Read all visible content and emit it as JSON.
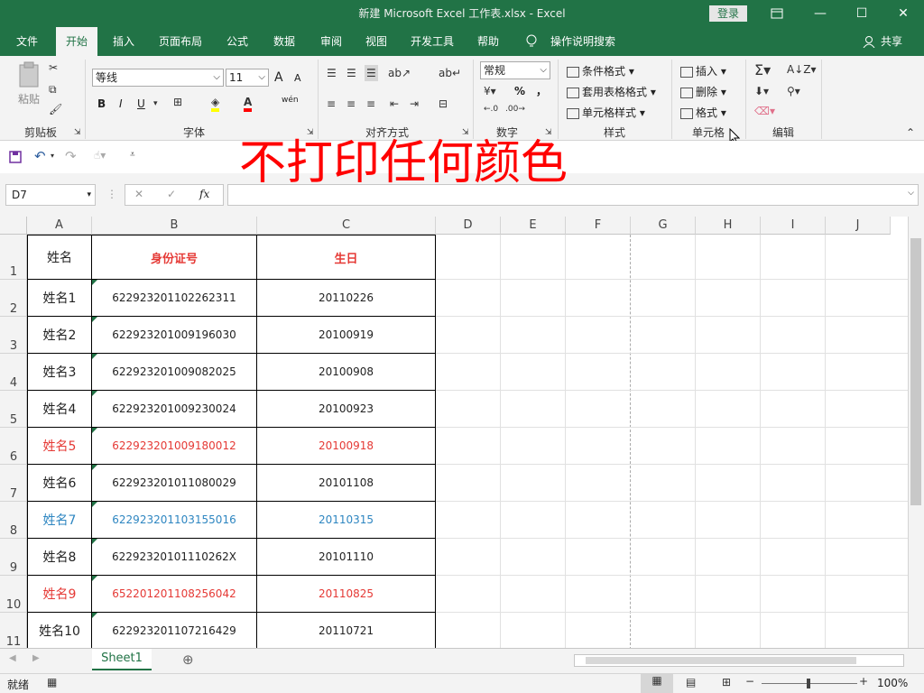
{
  "titlebar": {
    "title": "新建 Microsoft Excel 工作表.xlsx  -  Excel",
    "signin": "登录",
    "restore_icon": "ribbon-display-icon",
    "minimize": "—",
    "maximize": "☐",
    "close": "✕"
  },
  "tabs": [
    "文件",
    "开始",
    "插入",
    "页面布局",
    "公式",
    "数据",
    "审阅",
    "视图",
    "开发工具",
    "帮助"
  ],
  "tell_me": "操作说明搜索",
  "share": "共享",
  "ribbon": {
    "clipboard": {
      "paste": "粘贴",
      "label": "剪贴板"
    },
    "font": {
      "name": "等线",
      "size": "11",
      "bold": "B",
      "italic": "I",
      "underline": "U",
      "grow": "A",
      "shrink": "A",
      "wen": "wén",
      "label": "字体"
    },
    "alignment": {
      "label": "对齐方式"
    },
    "number": {
      "format": "常规",
      "percent": "%",
      "comma": "，",
      "label": "数字"
    },
    "styles": {
      "cond": "条件格式",
      "table": "套用表格格式",
      "cell": "单元格样式",
      "label": "样式"
    },
    "cells": {
      "insert": "插入",
      "delete": "删除",
      "format": "格式",
      "label": "单元格"
    },
    "editing": {
      "label": "编辑"
    }
  },
  "formula_bar": {
    "name_box": "D7",
    "fx": "fx",
    "formula": ""
  },
  "columns": [
    "A",
    "B",
    "C",
    "D",
    "E",
    "F",
    "G",
    "H",
    "I",
    "J"
  ],
  "rows": [
    "1",
    "2",
    "3",
    "4",
    "5",
    "6",
    "7",
    "8",
    "9",
    "10",
    "11"
  ],
  "header_row": {
    "name": "姓名",
    "id": "身份证号",
    "birthday": "生日"
  },
  "table": [
    {
      "name": "姓名1",
      "id": "622923201102262311",
      "birthday": "20110226",
      "color": "#222222"
    },
    {
      "name": "姓名2",
      "id": "622923201009196030",
      "birthday": "20100919",
      "color": "#222222"
    },
    {
      "name": "姓名3",
      "id": "622923201009082025",
      "birthday": "20100908",
      "color": "#222222"
    },
    {
      "name": "姓名4",
      "id": "622923201009230024",
      "birthday": "20100923",
      "color": "#222222"
    },
    {
      "name": "姓名5",
      "id": "622923201009180012",
      "birthday": "20100918",
      "color": "#e53935"
    },
    {
      "name": "姓名6",
      "id": "622923201011080029",
      "birthday": "20101108",
      "color": "#222222"
    },
    {
      "name": "姓名7",
      "id": "622923201103155016",
      "birthday": "20110315",
      "color": "#2e86c1"
    },
    {
      "name": "姓名8",
      "id": "62292320101110262X",
      "birthday": "20101110",
      "color": "#222222"
    },
    {
      "name": "姓名9",
      "id": "652201201108256042",
      "birthday": "20110825",
      "color": "#e53935"
    },
    {
      "name": "姓名10",
      "id": "622923201107216429",
      "birthday": "20110721",
      "color": "#222222"
    }
  ],
  "overlay_text": "不打印任何颜色",
  "sheet_tab": "Sheet1",
  "status": {
    "ready": "就绪",
    "zoom": "100%"
  },
  "colors": {
    "accent": "#217346",
    "header_red": "#e53935"
  }
}
